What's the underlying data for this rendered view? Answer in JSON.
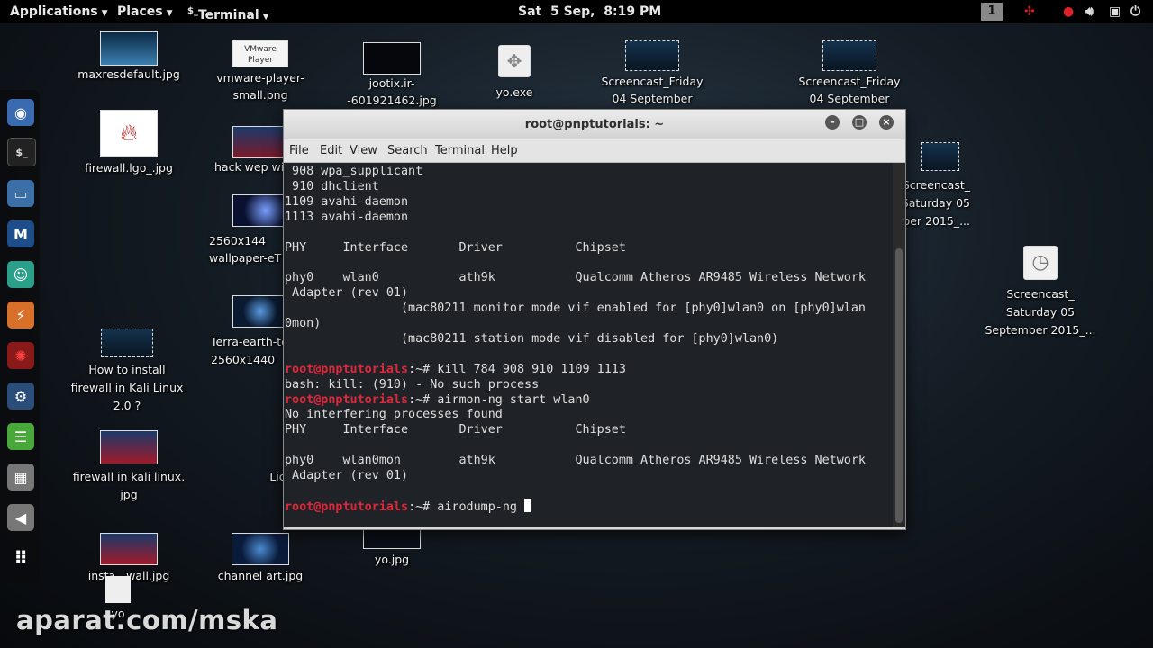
{
  "topbar": {
    "applications": "Applications",
    "places": "Places",
    "terminal": "Terminal",
    "clock": "Sat  5 Sep,  8:19 PM",
    "workspace": "1",
    "icons": [
      "network-icon",
      "record-icon",
      "volume-icon",
      "battery-icon",
      "power-icon"
    ]
  },
  "dock": {
    "icons": [
      "iceweasel-icon",
      "terminal-icon",
      "files-icon",
      "metasploit-icon",
      "armitage-icon",
      "burpsuite-icon",
      "faraday-icon",
      "leafpad-icon",
      "text-editor-icon",
      "settings-icon",
      "show-apps-icon"
    ]
  },
  "desktop": {
    "icons": [
      {
        "label": "maxresdefault.jpg"
      },
      {
        "label": "vmware-player-small.png",
        "thumb_text": "VMware Player"
      },
      {
        "label": "jootix.ir--601921462.jpg"
      },
      {
        "label": "yo.exe"
      },
      {
        "label": "Screencast_Friday 04 September"
      },
      {
        "label": "Screencast_Friday 04 September"
      },
      {
        "label": "firewall.lgo_.jpg"
      },
      {
        "label": "hack wep wi"
      },
      {
        "label": "Screencast_ Saturday 05 September 2015_..."
      },
      {
        "label": "2560x144 wallpaper-eT"
      },
      {
        "label": "Screencast_ Saturday 05 September 2015_..."
      },
      {
        "label": "Terra-earth-terra- 2560x1440"
      },
      {
        "label": "How to install firewall in Kali Linux 2.0 ?"
      },
      {
        "label": "firewall in kali linux. jpg"
      },
      {
        "label": "Lic"
      },
      {
        "label": "insta   wall.jpg"
      },
      {
        "label": "channel art.jpg"
      },
      {
        "label": "yo.jpg"
      },
      {
        "label": "yo"
      }
    ]
  },
  "terminal": {
    "title": "root@pnptutorials: ~",
    "menu": [
      "File",
      "Edit",
      "View",
      "Search",
      "Terminal",
      "Help"
    ],
    "lines": [
      {
        "text": " 908 wpa_supplicant"
      },
      {
        "text": " 910 dhclient"
      },
      {
        "text": "1109 avahi-daemon"
      },
      {
        "text": "1113 avahi-daemon"
      },
      {
        "text": ""
      },
      {
        "text": "PHY     Interface       Driver          Chipset"
      },
      {
        "text": ""
      },
      {
        "text": "phy0    wlan0           ath9k           Qualcomm Atheros AR9485 Wireless Network"
      },
      {
        "text": " Adapter (rev 01)"
      },
      {
        "text": "                (mac80211 monitor mode vif enabled for [phy0]wlan0 on [phy0]wlan"
      },
      {
        "text": "0mon)"
      },
      {
        "text": "                (mac80211 station mode vif disabled for [phy0]wlan0)"
      },
      {
        "text": ""
      },
      {
        "prompt": "root@pnptutorials",
        "text": ":~# kill 784 908 910 1109 1113"
      },
      {
        "text": "bash: kill: (910) - No such process"
      },
      {
        "prompt": "root@pnptutorials",
        "text": ":~# airmon-ng start wlan0"
      },
      {
        "text": "No interfering processes found"
      },
      {
        "text": "PHY     Interface       Driver          Chipset"
      },
      {
        "text": ""
      },
      {
        "text": "phy0    wlan0mon        ath9k           Qualcomm Atheros AR9485 Wireless Network"
      },
      {
        "text": " Adapter (rev 01)"
      },
      {
        "text": ""
      },
      {
        "prompt": "root@pnptutorials",
        "text": ":~# airodump-ng ",
        "cursor": true
      }
    ]
  },
  "watermark": "aparat.com/mska"
}
